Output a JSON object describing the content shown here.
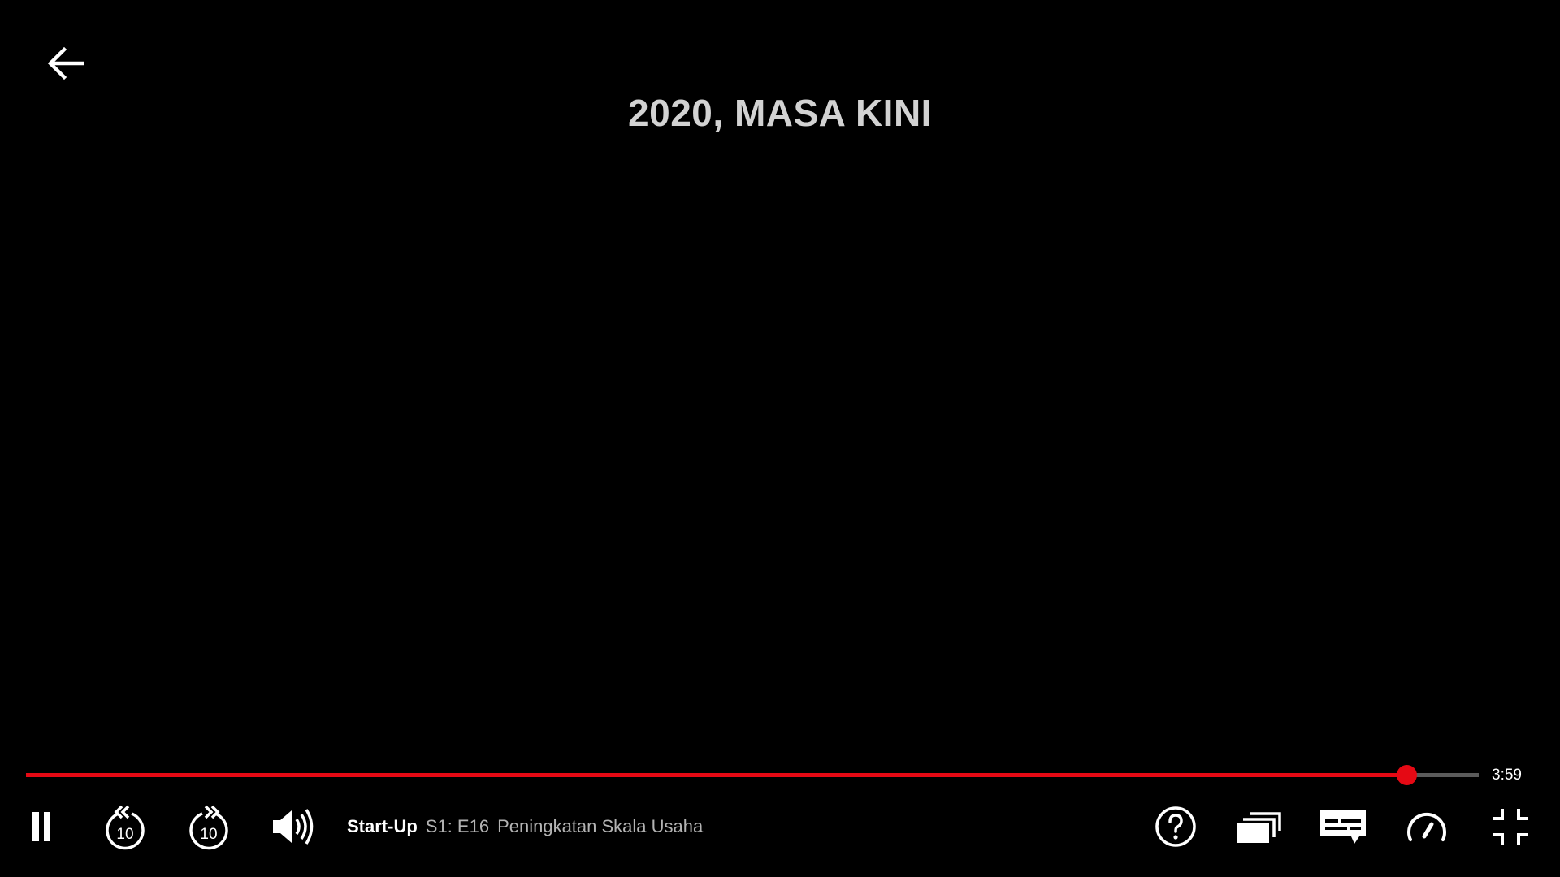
{
  "player": {
    "video_text": "2020, MASA KINI",
    "progress": 0.95,
    "time_remaining": "3:59",
    "accent_color": "#e50914"
  },
  "title_info": {
    "show": "Start-Up",
    "episode": "S1: E16",
    "episode_title": "Peningkatan Skala Usaha"
  },
  "controls": {
    "left": [
      "pause-icon",
      "rewind-10-icon",
      "forward-10-icon",
      "volume-icon"
    ],
    "right": [
      "help-icon",
      "episodes-icon",
      "subtitles-icon",
      "playback-speed-icon",
      "exit-fullscreen-icon"
    ],
    "skip_seconds": "10"
  },
  "back_icon": "arrow-left-icon"
}
